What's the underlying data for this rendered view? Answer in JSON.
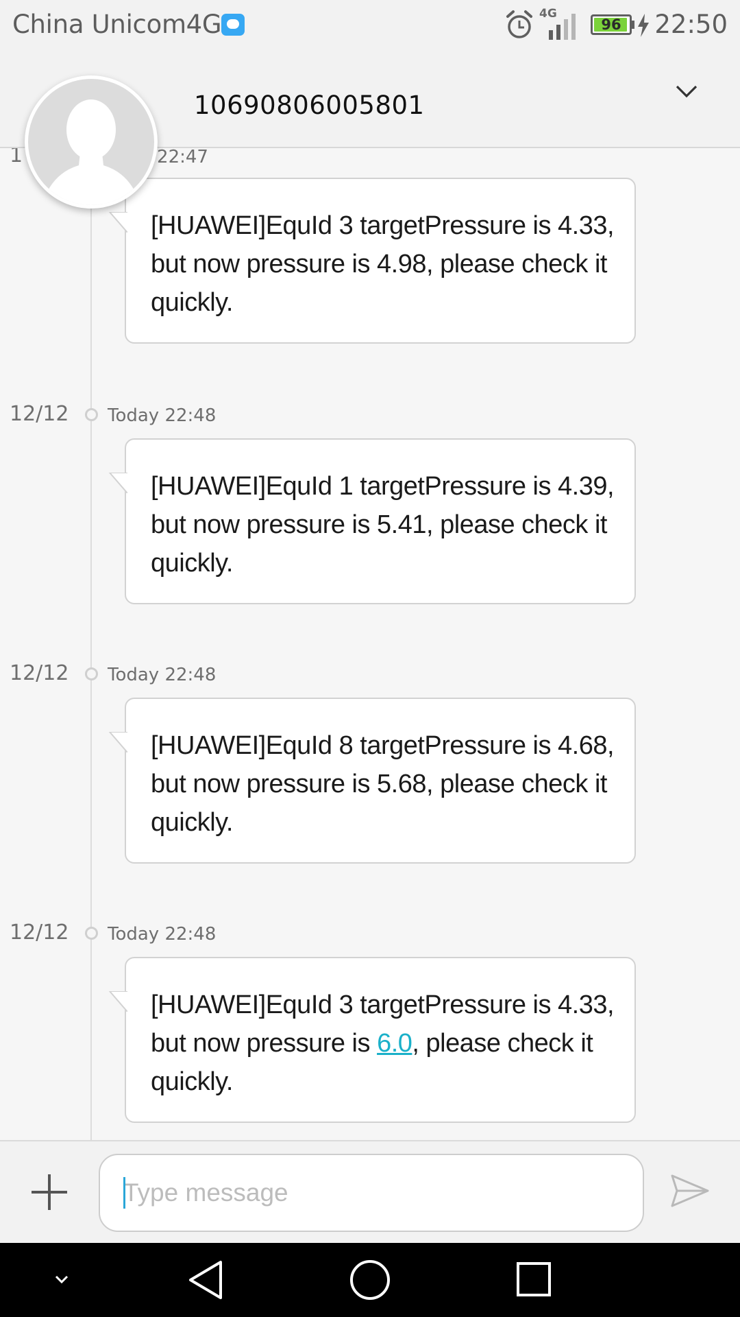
{
  "status_bar": {
    "carrier": "China Unicom4G",
    "network": "4G",
    "battery": "96",
    "battery_level": 0.96,
    "time": "22:50"
  },
  "header": {
    "contact_number": "10690806005801"
  },
  "messages": [
    {
      "date": "1",
      "time": "/ 22:47",
      "text": "[HUAWEI]EquId 3 targetPressure is 4.33, but now pressure is 4.98, please check it quickly."
    },
    {
      "date": "12/12",
      "time": "Today 22:48",
      "text": "[HUAWEI]EquId 1 targetPressure is 4.39, but now pressure is 5.41, please check it quickly."
    },
    {
      "date": "12/12",
      "time": "Today 22:48",
      "text": "[HUAWEI]EquId 8 targetPressure is 4.68, but now pressure is 5.68, please check it quickly."
    },
    {
      "date": "12/12",
      "time": "Today 22:48",
      "text_before": "[HUAWEI]EquId 3 targetPressure is 4.33, but now pressure is ",
      "link": "6.0",
      "text_after": ", please check it quickly."
    }
  ],
  "composer": {
    "placeholder": "Type message",
    "value": ""
  },
  "colors": {
    "link": "#1ab0c9",
    "battery_fill": "#7bd23a",
    "background": "#f6f6f6"
  },
  "icons": {
    "status": [
      "message-notification-icon",
      "alarm-icon",
      "signal-icon",
      "battery-icon",
      "charging-icon"
    ],
    "header": [
      "expand-chevron-icon"
    ],
    "composer": [
      "add-icon",
      "send-icon"
    ],
    "navigation": [
      "hide-keyboard-icon",
      "back-icon",
      "home-icon",
      "recents-icon"
    ]
  }
}
